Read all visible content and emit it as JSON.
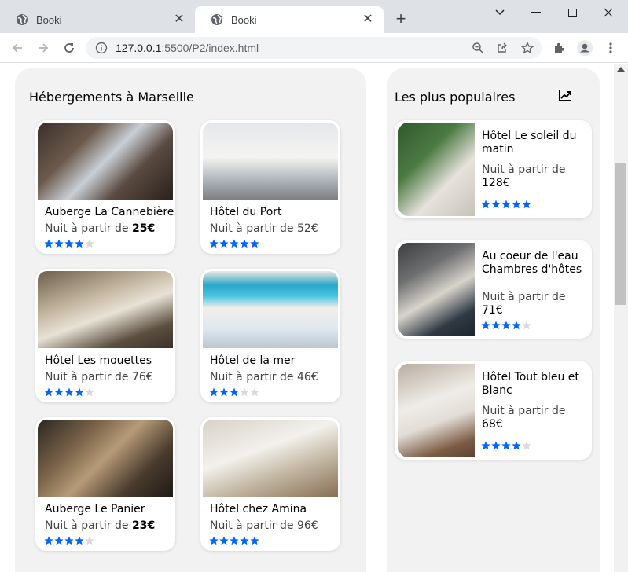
{
  "browser": {
    "tabs": [
      {
        "title": "Booki",
        "active": false
      },
      {
        "title": "Booki",
        "active": true
      }
    ],
    "url_host": "127.0.0.1",
    "url_rest": ":5500/P2/index.html"
  },
  "colors": {
    "star_on": "#0065fc",
    "star_off": "#d9d9d9",
    "panel_bg": "#f2f2f2"
  },
  "left": {
    "title": "Hébergements à Marseille",
    "price_prefix": "Nuit à partir de",
    "cards": [
      {
        "name": "Auberge La Cannebière",
        "price": "25€",
        "price_bold": true,
        "rating": 4,
        "photo": "photo-bunk-room"
      },
      {
        "name": "Hôtel du Port",
        "price": "52€",
        "price_bold": false,
        "rating": 5,
        "photo": "photo-bright-room"
      },
      {
        "name": "Hôtel Les mouettes",
        "price": "76€",
        "price_bold": false,
        "rating": 4,
        "photo": "photo-modern-room"
      },
      {
        "name": "Hôtel de la mer",
        "price": "46€",
        "price_bold": false,
        "rating": 3,
        "photo": "photo-sea-painting-room"
      },
      {
        "name": "Auberge Le Panier",
        "price": "23€",
        "price_bold": true,
        "rating": 4,
        "photo": "photo-dorm-room"
      },
      {
        "name": "Hôtel chez Amina",
        "price": "96€",
        "price_bold": false,
        "rating": 5,
        "photo": "photo-classic-room"
      }
    ]
  },
  "right": {
    "title": "Les plus populaires",
    "icon": "trending-chart-icon",
    "price_prefix": "Nuit à partir de",
    "cards": [
      {
        "name": "Hôtel Le soleil du matin",
        "price": "128€",
        "rating": 5,
        "photo": "photo-green-room"
      },
      {
        "name": "Au coeur de l'eau Chambres d'hôtes",
        "price": "71€",
        "rating": 4,
        "photo": "photo-dark-room"
      },
      {
        "name": "Hôtel Tout bleu et Blanc",
        "price": "68€",
        "rating": 4,
        "photo": "photo-white-room"
      }
    ]
  }
}
